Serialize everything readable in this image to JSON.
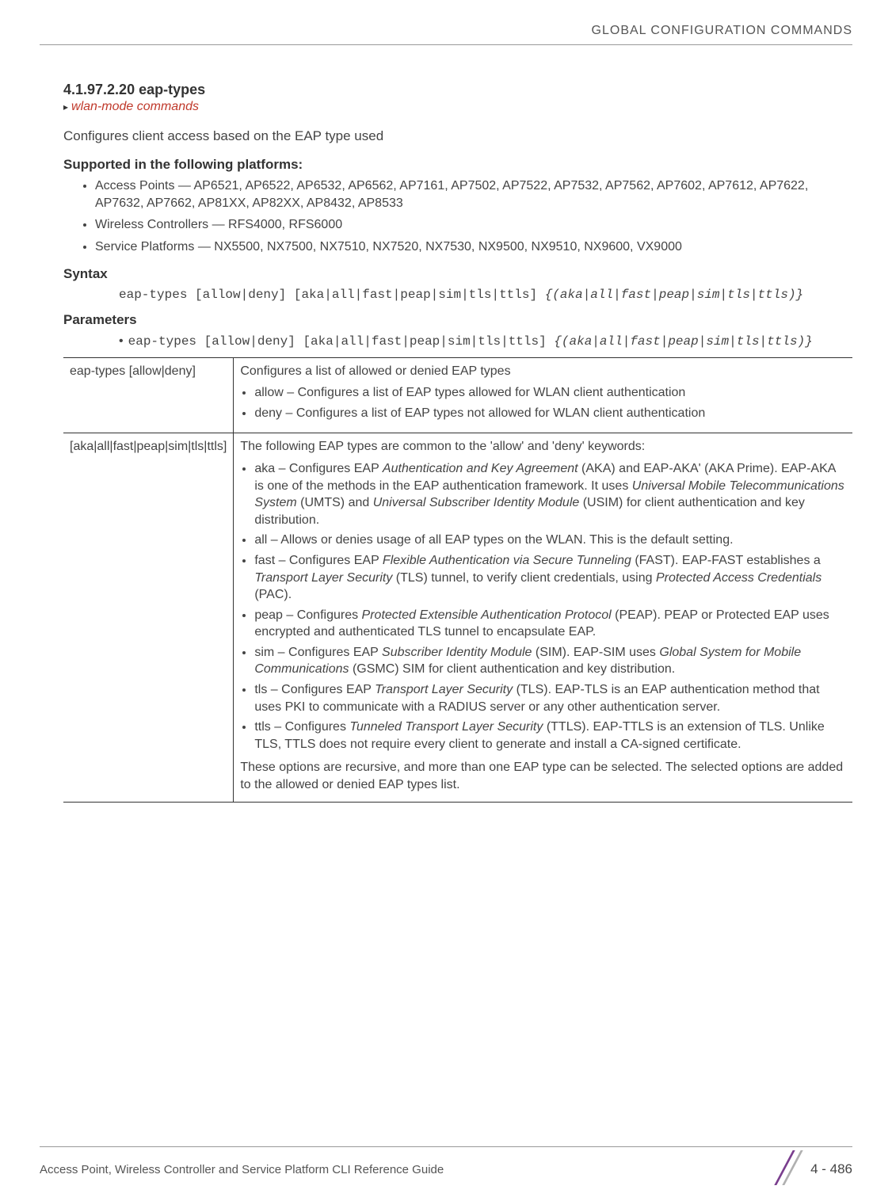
{
  "header": "GLOBAL CONFIGURATION COMMANDS",
  "section": {
    "number": "4.1.97.2.20 eap-types",
    "breadcrumb": "wlan-mode commands",
    "intro": "Configures client access based on the EAP type used"
  },
  "supported": {
    "heading": "Supported in the following platforms:",
    "items": [
      "Access Points — AP6521, AP6522, AP6532, AP6562, AP7161, AP7502, AP7522, AP7532, AP7562, AP7602, AP7612, AP7622, AP7632, AP7662, AP81XX, AP82XX, AP8432, AP8533",
      "Wireless Controllers — RFS4000, RFS6000",
      "Service Platforms — NX5500, NX7500, NX7510, NX7520, NX7530, NX9500, NX9510, NX9600, VX9000"
    ]
  },
  "syntax": {
    "heading": "Syntax",
    "line_plain": "eap-types [allow|deny] [aka|all|fast|peap|sim|tls|ttls] ",
    "line_ital": "{(aka|all|fast|peap|sim|tls|ttls)}"
  },
  "parameters": {
    "heading": "Parameters",
    "line_plain": "eap-types [allow|deny] [aka|all|fast|peap|sim|tls|ttls] ",
    "line_ital": "{(aka|all|fast|peap|sim|tls|ttls)}"
  },
  "table": {
    "row1": {
      "left": "eap-types [allow|deny]",
      "desc": "Configures a list of allowed or denied EAP types",
      "bullets": [
        "allow – Configures a list of EAP types allowed for WLAN client authentication",
        "deny – Configures a list of EAP types not allowed for WLAN client authentication"
      ]
    },
    "row2": {
      "left": "[aka|all|fast|peap|sim|tls|ttls]",
      "desc": "The following EAP types are common to the 'allow' and 'deny' keywords:",
      "bullets": [
        "aka – Configures EAP <i>Authentication and Key Agreement</i> (AKA) and EAP-AKA' (AKA Prime). EAP-AKA is one of the methods in the EAP authentication framework. It uses <i>Universal Mobile Telecommunications System</i> (UMTS) and <i>Universal Subscriber Identity Module</i> (USIM) for client authentication and key distribution.",
        "all – Allows or denies usage of all EAP types on the WLAN. This is the default setting.",
        "fast – Configures EAP <i>Flexible Authentication via Secure Tunneling</i> (FAST). EAP-FAST establishes a <i>Transport Layer Security</i> (TLS) tunnel, to verify client credentials, using <i>Protected Access Credentials</i> (PAC).",
        "peap – Configures <i>Protected Extensible Authentication Protocol</i> (PEAP). PEAP or Protected EAP uses encrypted and authenticated TLS tunnel to encapsulate EAP.",
        "sim – Configures EAP <i>Subscriber Identity Module</i> (SIM). EAP-SIM uses <i>Global System for Mobile Communications</i> (GSMC) SIM for client authentication and key distribution.",
        "tls – Configures EAP <i>Transport Layer Security</i> (TLS). EAP-TLS is an EAP authentication method that uses PKI to communicate with a RADIUS server or any other authentication server.",
        "ttls – Configures <i>Tunneled Transport Layer Security</i> (TTLS). EAP-TTLS is an extension of TLS. Unlike TLS, TTLS does not require every client to generate and install a CA-signed certificate."
      ],
      "footer": "These options are recursive, and more than one EAP type can be selected. The selected options are added to the allowed or denied EAP types list."
    }
  },
  "footer": {
    "left": "Access Point, Wireless Controller and Service Platform CLI Reference Guide",
    "page": "4 - 486"
  }
}
